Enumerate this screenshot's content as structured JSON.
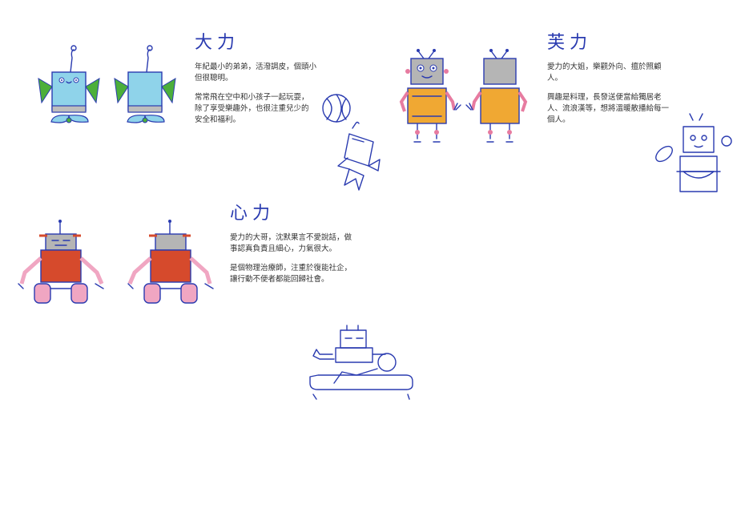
{
  "characters": [
    {
      "name": "大力",
      "paragraphs": [
        "年紀最小的弟弟，活潑調皮，個頭小\n但很聰明。",
        "常常飛在空中和小孩子一起玩耍，\n除了享受樂趣外，也很注重兒少的\n安全和福利。"
      ]
    },
    {
      "name": "芙力",
      "paragraphs": [
        "愛力的大姐，樂觀外向、擅於照顧\n人。",
        "興趣是料理，長發送便當給獨居老\n人、流浪漢等，想將溫暖散播給每一\n個人。"
      ]
    },
    {
      "name": "心力",
      "paragraphs": [
        "愛力的大哥，沈默果言不愛說話，做\n事認真負責且細心，力氣很大。",
        "是個物理治療師，注重於復能社企，\n讓行動不便者都能回歸社會。"
      ]
    }
  ],
  "colors": {
    "line": "#2a3bb0",
    "dali_body": "#8fd3ea",
    "dali_fin": "#4caf3a",
    "fuli_body": "#f0a833",
    "fuli_head": "#b5b5b5",
    "fuli_arm": "#e77ba0",
    "xinli_body": "#d64a2c",
    "xinli_arm": "#f0a6c2"
  }
}
